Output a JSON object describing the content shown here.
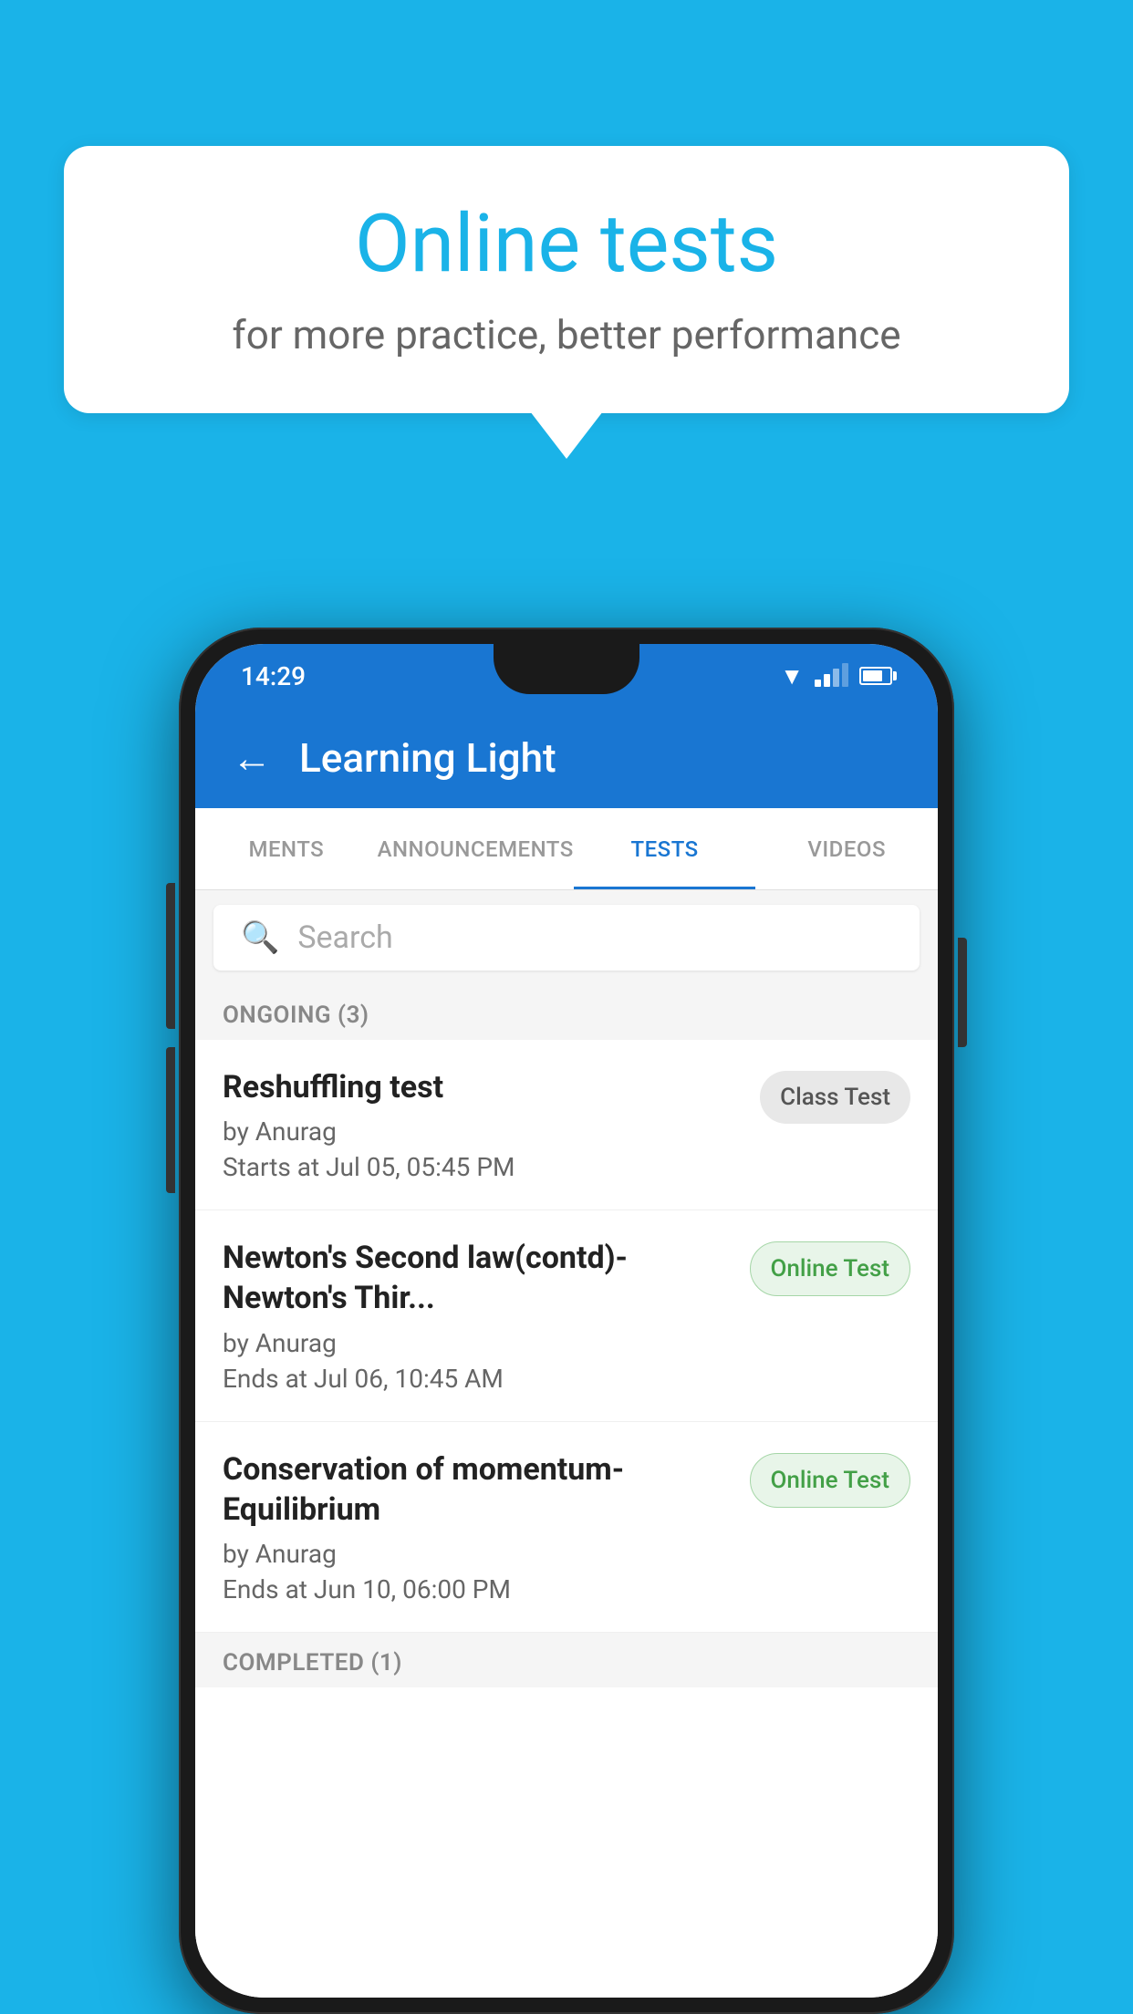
{
  "background_color": "#1ab3e8",
  "speech_bubble": {
    "title": "Online tests",
    "subtitle": "for more practice, better performance"
  },
  "phone": {
    "status_bar": {
      "time": "14:29",
      "icons": [
        "wifi",
        "signal",
        "battery"
      ]
    },
    "app_bar": {
      "back_label": "←",
      "title": "Learning Light"
    },
    "tabs": [
      {
        "label": "MENTS",
        "active": false
      },
      {
        "label": "ANNOUNCEMENTS",
        "active": false
      },
      {
        "label": "TESTS",
        "active": true
      },
      {
        "label": "VIDEOS",
        "active": false
      }
    ],
    "search": {
      "placeholder": "Search"
    },
    "section_ongoing": {
      "label": "ONGOING (3)"
    },
    "tests": [
      {
        "title": "Reshuffling test",
        "author": "by Anurag",
        "date": "Starts at  Jul 05, 05:45 PM",
        "badge": "Class Test",
        "badge_type": "class"
      },
      {
        "title": "Newton's Second law(contd)-Newton's Thir...",
        "author": "by Anurag",
        "date": "Ends at  Jul 06, 10:45 AM",
        "badge": "Online Test",
        "badge_type": "online"
      },
      {
        "title": "Conservation of momentum-Equilibrium",
        "author": "by Anurag",
        "date": "Ends at  Jun 10, 06:00 PM",
        "badge": "Online Test",
        "badge_type": "online"
      }
    ],
    "section_completed": {
      "label": "COMPLETED (1)"
    }
  }
}
